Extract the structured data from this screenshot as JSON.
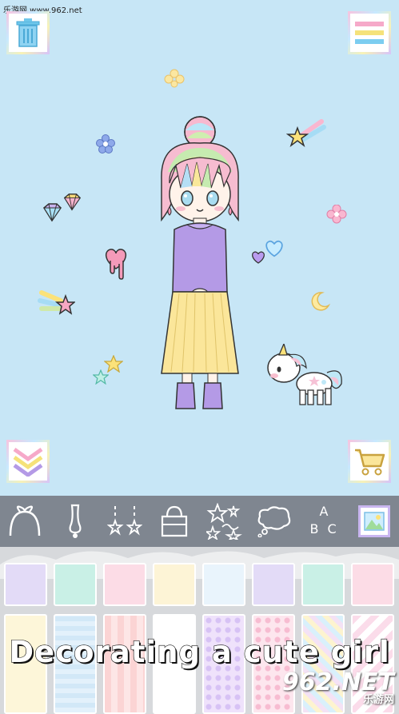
{
  "watermark_top": "乐游网 www.962.net",
  "caption": "Decorating a cute girl",
  "watermark_bottom": {
    "logo": "962.NET",
    "sub": "乐游网"
  },
  "buttons": {
    "trash_icon": "trash-icon",
    "menu_icon": "menu-icon",
    "down_icon": "chevron-down-icon",
    "cart_icon": "cart-icon"
  },
  "toolbar": {
    "tools": [
      {
        "name": "headband",
        "icon": "headband-icon"
      },
      {
        "name": "earring",
        "icon": "earring-icon"
      },
      {
        "name": "dangle-earrings",
        "icon": "dangle-earrings-icon"
      },
      {
        "name": "bag",
        "icon": "bag-icon"
      },
      {
        "name": "sparkles",
        "icon": "sparkles-icon"
      },
      {
        "name": "speech-bubble",
        "icon": "speech-bubble-icon"
      },
      {
        "name": "letters",
        "icon": "letters-icon",
        "label_a": "A",
        "label_b": "B",
        "label_c": "C"
      },
      {
        "name": "background",
        "icon": "picture-icon",
        "selected": true
      }
    ]
  },
  "colors": {
    "scene_bg": "#c7e6f6",
    "toolbar_bg": "#7f8690",
    "panel_bg": "#d7d9dc"
  },
  "swatches_row1": [
    "#e3dbf7",
    "#c9f0e6",
    "#fcdce6",
    "#fdf4d6",
    "#e9f4fc",
    "#e3dbf7",
    "#c9f0e6",
    "#fcdce6"
  ],
  "swatches_row2": [
    "#fdf6d9",
    "#e3f1fb",
    "#fbd4d4",
    "#ffffff",
    "#efe2fb",
    "#fde6ee",
    "#f4e2f5",
    "#fbdcea"
  ]
}
